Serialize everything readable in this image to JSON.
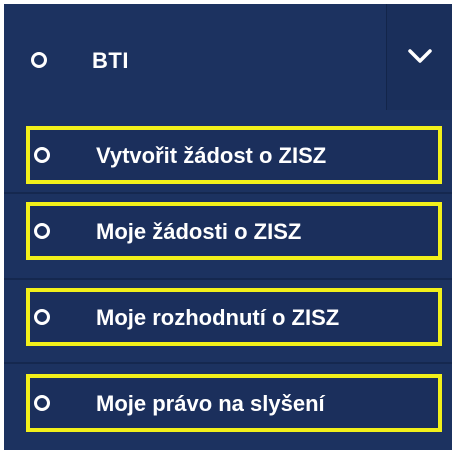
{
  "header": {
    "label": "BTI",
    "toggle_icon": "chevron-down-icon"
  },
  "menu": {
    "items": [
      {
        "label": "Vytvořit žádost o ZISZ"
      },
      {
        "label": "Moje žádosti o ZISZ"
      },
      {
        "label": "Moje rozhodnutí o ZISZ"
      },
      {
        "label": "Moje právo na slyšení"
      }
    ]
  },
  "colors": {
    "background": "#1c3260",
    "text": "#ffffff",
    "highlight_border": "#f2f01a"
  }
}
